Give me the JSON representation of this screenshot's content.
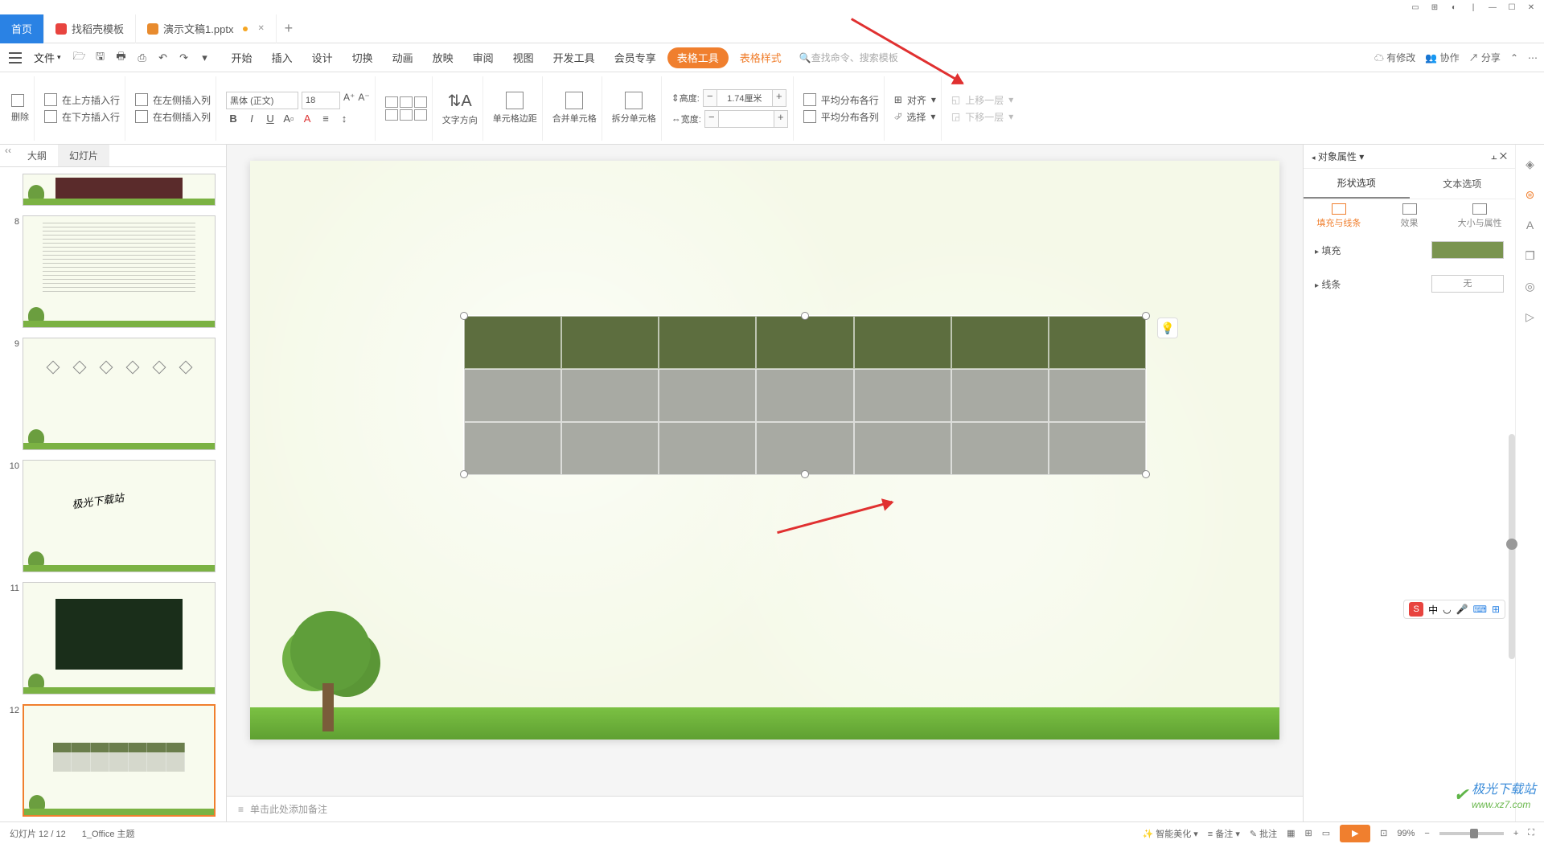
{
  "titlebar": {
    "icons": [
      "⊞",
      "⊟",
      "◧",
      "—",
      "☐",
      "✕"
    ]
  },
  "tabs": {
    "home": "首页",
    "tpl": "找稻壳模板",
    "file": "演示文稿1.pptx"
  },
  "menu": {
    "file": "文件",
    "items": [
      "开始",
      "插入",
      "设计",
      "切换",
      "动画",
      "放映",
      "审阅",
      "视图",
      "开发工具",
      "会员专享",
      "表格工具",
      "表格样式"
    ],
    "search_ph": "查找命令、搜索模板",
    "right": {
      "changes": "有修改",
      "coop": "协作",
      "share": "分享"
    }
  },
  "ribbon": {
    "delete": "删除",
    "ins_row_above": "在上方插入行",
    "ins_row_below": "在下方插入行",
    "ins_col_left": "在左侧插入列",
    "ins_col_right": "在右侧插入列",
    "font_name": "黑体 (正文)",
    "font_size": "18",
    "text_dir": "文字方向",
    "cell_margin": "单元格边距",
    "merge": "合并单元格",
    "split": "拆分单元格",
    "height_lbl": "高度:",
    "height_val": "1.74厘米",
    "width_lbl": "宽度:",
    "width_val": "",
    "dist_rows": "平均分布各行",
    "dist_cols": "平均分布各列",
    "align": "对齐",
    "select": "选择",
    "bring_fwd": "上移一层",
    "send_back": "下移一层"
  },
  "sidepanel": {
    "tab1": "大纲",
    "tab2": "幻灯片",
    "slide_nums": [
      "8",
      "9",
      "10",
      "11",
      "12"
    ]
  },
  "notes": {
    "placeholder": "单击此处添加备注"
  },
  "props": {
    "title": "对象属性",
    "tab_shape": "形状选项",
    "tab_text": "文本选项",
    "sub_fill": "填充与线条",
    "sub_effect": "效果",
    "sub_size": "大小与属性",
    "sec_fill": "填充",
    "sec_line": "线条",
    "none": "无"
  },
  "status": {
    "slide_count": "幻灯片 12 / 12",
    "theme": "1_Office 主题",
    "beautify": "智能美化",
    "notes": "备注",
    "review": "批注",
    "zoom": "99%"
  },
  "ime": {
    "zh": "中"
  },
  "watermark": {
    "t1": "极光下载站",
    "t2": "www.xz7.com"
  }
}
